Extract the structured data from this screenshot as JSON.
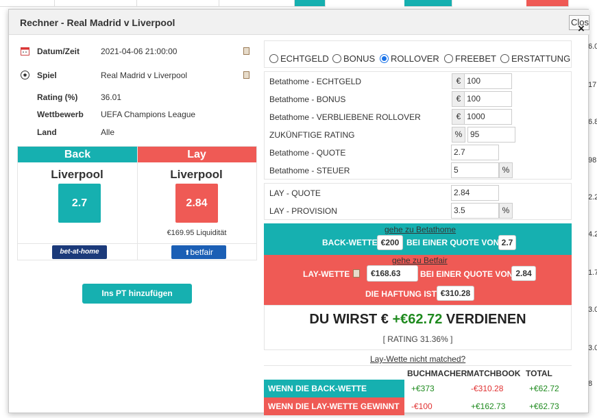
{
  "background": {
    "right_numbers": [
      "6.0",
      "17",
      "6.8",
      "98",
      "2.2",
      "4.2",
      "1.7",
      "3.0",
      "3.0",
      "8"
    ]
  },
  "modal": {
    "title": "Rechner - Real Madrid v Liverpool",
    "close_label": "Close",
    "close_icon": "×"
  },
  "info": {
    "rows": [
      {
        "label": "Datum/Zeit",
        "value": "2021-04-06 21:00:00",
        "icon": "calendar-icon"
      },
      {
        "label": "Spiel",
        "value": "Real Madrid v Liverpool",
        "icon": "football-icon"
      },
      {
        "label": "Rating (%)",
        "value": "36.01"
      },
      {
        "label": "Wettbewerb",
        "value": "UEFA Champions League"
      },
      {
        "label": "Land",
        "value": "Alle"
      }
    ]
  },
  "back": {
    "header": "Back",
    "team": "Liverpool",
    "odds": "2.7",
    "bookmaker_logo": "bet-at-home"
  },
  "lay": {
    "header": "Lay",
    "team": "Liverpool",
    "odds": "2.84",
    "liquidity": "€169.95 Liquidität",
    "exchange_logo": "betfair"
  },
  "add_pt_button": "Ins PT hinzufügen",
  "bet_types": {
    "options": [
      "ECHTGELD",
      "BONUS",
      "ROLLOVER",
      "FREEBET",
      "ERSTATTUNG"
    ],
    "selected": "ROLLOVER"
  },
  "form": {
    "echtgeld_label": "Betathome - ECHTGELD",
    "echtgeld_value": "100",
    "bonus_label": "Betathome - BONUS",
    "bonus_value": "100",
    "rollover_label": "Betathome - VERBLIEBENE ROLLOVER",
    "rollover_value": "1000",
    "rating_label": "ZUKÜNFTIGE RATING",
    "rating_value": "95",
    "quote_label": "Betathome - QUOTE",
    "quote_value": "2.7",
    "steuer_label": "Betathome - STEUER",
    "steuer_value": "5",
    "currency": "€",
    "percent": "%"
  },
  "lay_form": {
    "quote_label": "LAY - QUOTE",
    "quote_value": "2.84",
    "provision_label": "LAY - PROVISION",
    "provision_value": "3.5"
  },
  "back_instr": {
    "link": "gehe zu Betathome",
    "prefix": "BACK-WETTE",
    "stake": "€200",
    "middle": "BEI EINER QUOTE VON",
    "odds": "2.7"
  },
  "lay_instr": {
    "link": "gehe zu Betfair",
    "prefix": "LAY-WETTE",
    "stake": "€168.63",
    "middle": "BEI EINER QUOTE VON",
    "odds": "2.84",
    "liability_label": "DIE HAFTUNG IST",
    "liability": "€310.28"
  },
  "result": {
    "prefix": "DU WIRST €",
    "amount": "+€62.72",
    "suffix": "VERDIENEN",
    "rating": "[ RATING 31.36% ]"
  },
  "not_matched_link": "Lay-Wette nicht matched?",
  "outcome_table": {
    "headers": [
      "BUCHMACHER",
      "MATCHBOOK",
      "TOTAL"
    ],
    "rows": [
      {
        "label": "WENN DIE BACK-WETTE GEWINNT",
        "values": [
          "+€373",
          "-€310.28",
          "+€62.72"
        ]
      },
      {
        "label": "WENN DIE LAY-WETTE GEWINNT",
        "values": [
          "-€100",
          "+€162.73",
          "+€62.73"
        ]
      }
    ]
  },
  "colors": {
    "teal": "#16b0b0",
    "red": "#ef5a55",
    "green": "#1e8a1e",
    "negative": "#e03030"
  }
}
